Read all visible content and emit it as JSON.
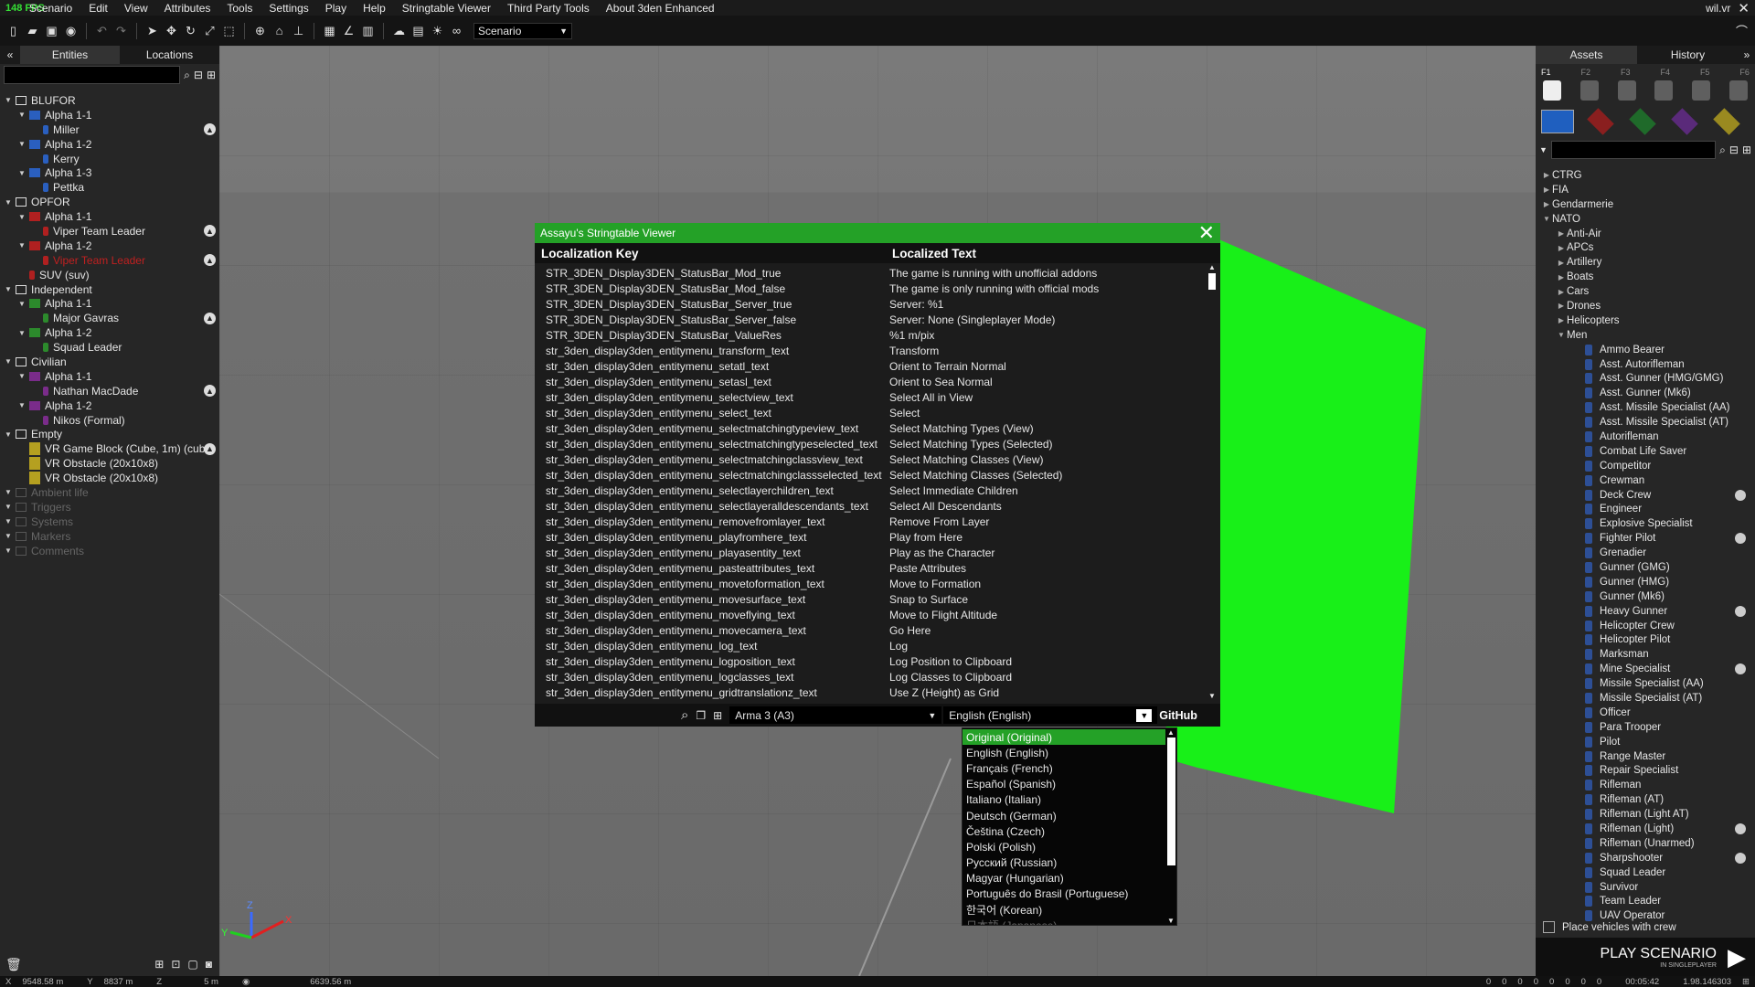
{
  "menubar": {
    "fps": "148 FPS",
    "items": [
      "Scenario",
      "Edit",
      "View",
      "Attributes",
      "Tools",
      "Settings",
      "Play",
      "Help",
      "Stringtable Viewer",
      "Third Party Tools",
      "About 3den Enhanced"
    ],
    "map_name": "wil.vr"
  },
  "toolbar": {
    "scenario_dropdown": "Scenario"
  },
  "left_panel": {
    "tabs": [
      "Entities",
      "Locations"
    ],
    "tree": [
      {
        "label": "BLUFOR",
        "level": 0,
        "kind": "folder"
      },
      {
        "label": "Alpha 1-1",
        "level": 1,
        "kind": "group",
        "color": "#2a5fbf"
      },
      {
        "label": "Miller",
        "level": 2,
        "kind": "unit",
        "color": "#2a5fbf",
        "badge": true
      },
      {
        "label": "Alpha 1-2",
        "level": 1,
        "kind": "group",
        "color": "#2a5fbf"
      },
      {
        "label": "Kerry",
        "level": 2,
        "kind": "unit",
        "color": "#2a5fbf"
      },
      {
        "label": "Alpha 1-3",
        "level": 1,
        "kind": "group",
        "color": "#2a5fbf"
      },
      {
        "label": "Pettka",
        "level": 2,
        "kind": "unit",
        "color": "#2a5fbf"
      },
      {
        "label": "OPFOR",
        "level": 0,
        "kind": "folder"
      },
      {
        "label": "Alpha 1-1",
        "level": 1,
        "kind": "group",
        "color": "#b02020"
      },
      {
        "label": "Viper Team Leader",
        "level": 2,
        "kind": "unit",
        "color": "#b02020",
        "badge": true
      },
      {
        "label": "Alpha 1-2",
        "level": 1,
        "kind": "group",
        "color": "#b02020"
      },
      {
        "label": "Viper Team Leader",
        "level": 2,
        "kind": "unit",
        "color": "#b02020",
        "badge": true,
        "red": true
      },
      {
        "label": "SUV (suv)",
        "level": 1,
        "kind": "unit",
        "color": "#b02020"
      },
      {
        "label": "Independent",
        "level": 0,
        "kind": "folder"
      },
      {
        "label": "Alpha 1-1",
        "level": 1,
        "kind": "group",
        "color": "#2c8a2c"
      },
      {
        "label": "Major Gavras",
        "level": 2,
        "kind": "unit",
        "color": "#2c8a2c",
        "badge": true
      },
      {
        "label": "Alpha 1-2",
        "level": 1,
        "kind": "group",
        "color": "#2c8a2c"
      },
      {
        "label": "Squad Leader",
        "level": 2,
        "kind": "unit",
        "color": "#2c8a2c"
      },
      {
        "label": "Civilian",
        "level": 0,
        "kind": "folder"
      },
      {
        "label": "Alpha 1-1",
        "level": 1,
        "kind": "group",
        "color": "#7a2c8a"
      },
      {
        "label": "Nathan MacDade",
        "level": 2,
        "kind": "unit",
        "color": "#7a2c8a",
        "badge": true
      },
      {
        "label": "Alpha 1-2",
        "level": 1,
        "kind": "group",
        "color": "#7a2c8a"
      },
      {
        "label": "Nikos (Formal)",
        "level": 2,
        "kind": "unit",
        "color": "#7a2c8a"
      },
      {
        "label": "Empty",
        "level": 0,
        "kind": "folder"
      },
      {
        "label": "VR Game Block (Cube, 1m) (cube)",
        "level": 1,
        "kind": "object",
        "color": "#b5a020",
        "badge": true
      },
      {
        "label": "VR Obstacle (20x10x8)",
        "level": 1,
        "kind": "object",
        "color": "#b5a020"
      },
      {
        "label": "VR Obstacle (20x10x8)",
        "level": 1,
        "kind": "object",
        "color": "#b5a020"
      },
      {
        "label": "Ambient life",
        "level": 0,
        "kind": "folder",
        "dim": true
      },
      {
        "label": "Triggers",
        "level": 0,
        "kind": "folder",
        "dim": true
      },
      {
        "label": "Systems",
        "level": 0,
        "kind": "folder",
        "dim": true
      },
      {
        "label": "Markers",
        "level": 0,
        "kind": "folder",
        "dim": true
      },
      {
        "label": "Comments",
        "level": 0,
        "kind": "folder",
        "dim": true
      }
    ]
  },
  "right_panel": {
    "tabs": [
      "Assets",
      "History"
    ],
    "slots": [
      "F1",
      "F2",
      "F3",
      "F4",
      "F5",
      "F6"
    ],
    "side_colors": [
      "#1f5fbf",
      "#8a1f1f",
      "#1f6a2a",
      "#5a2a7a",
      "#9a8a20"
    ],
    "factions": [
      "CTRG",
      "FIA",
      "Gendarmerie",
      "NATO"
    ],
    "categories": [
      "Anti-Air",
      "APCs",
      "Artillery",
      "Boats",
      "Cars",
      "Drones",
      "Helicopters",
      "Men"
    ],
    "men": [
      "Ammo Bearer",
      "Asst. Autorifleman",
      "Asst. Gunner (HMG/GMG)",
      "Asst. Gunner (Mk6)",
      "Asst. Missile Specialist (AA)",
      "Asst. Missile Specialist (AT)",
      "Autorifleman",
      "Combat Life Saver",
      "Competitor",
      "Crewman",
      "Deck Crew",
      "Engineer",
      "Explosive Specialist",
      "Fighter Pilot",
      "Grenadier",
      "Gunner (GMG)",
      "Gunner (HMG)",
      "Gunner (Mk6)",
      "Heavy Gunner",
      "Helicopter Crew",
      "Helicopter Pilot",
      "Marksman",
      "Mine Specialist",
      "Missile Specialist (AA)",
      "Missile Specialist (AT)",
      "Officer",
      "Para Trooper",
      "Pilot",
      "Range Master",
      "Repair Specialist",
      "Rifleman",
      "Rifleman (AT)",
      "Rifleman (Light AT)",
      "Rifleman (Light)",
      "Rifleman (Unarmed)",
      "Sharpshooter",
      "Squad Leader",
      "Survivor",
      "Team Leader",
      "UAV Operator"
    ],
    "checkbox_label": "Place vehicles with crew",
    "play_label": "PLAY SCENARIO",
    "play_sub": "IN SINGLEPLAYER"
  },
  "dialog": {
    "title": "Assayu's Stringtable Viewer",
    "col_key": "Localization Key",
    "col_text": "Localized Text",
    "rows": [
      [
        "STR_3DEN_Display3DEN_StatusBar_Mod_true",
        "The game is running with unofficial addons"
      ],
      [
        "STR_3DEN_Display3DEN_StatusBar_Mod_false",
        "The game is only running with official mods"
      ],
      [
        "STR_3DEN_Display3DEN_StatusBar_Server_true",
        "Server: %1"
      ],
      [
        "STR_3DEN_Display3DEN_StatusBar_Server_false",
        "Server: None (Singleplayer Mode)"
      ],
      [
        "STR_3DEN_Display3DEN_StatusBar_ValueRes",
        "%1 m/pix"
      ],
      [
        "str_3den_display3den_entitymenu_transform_text",
        "Transform"
      ],
      [
        "str_3den_display3den_entitymenu_setatl_text",
        "Orient to Terrain Normal"
      ],
      [
        "str_3den_display3den_entitymenu_setasl_text",
        "Orient to Sea Normal"
      ],
      [
        "str_3den_display3den_entitymenu_selectview_text",
        "Select All in View"
      ],
      [
        "str_3den_display3den_entitymenu_select_text",
        "Select"
      ],
      [
        "str_3den_display3den_entitymenu_selectmatchingtypeview_text",
        "Select Matching Types (View)"
      ],
      [
        "str_3den_display3den_entitymenu_selectmatchingtypeselected_text",
        "Select Matching Types (Selected)"
      ],
      [
        "str_3den_display3den_entitymenu_selectmatchingclassview_text",
        "Select Matching Classes (View)"
      ],
      [
        "str_3den_display3den_entitymenu_selectmatchingclassselected_text",
        "Select Matching Classes (Selected)"
      ],
      [
        "str_3den_display3den_entitymenu_selectlayerchildren_text",
        "Select Immediate Children"
      ],
      [
        "str_3den_display3den_entitymenu_selectlayeralldescendants_text",
        "Select All Descendants"
      ],
      [
        "str_3den_display3den_entitymenu_removefromlayer_text",
        "Remove From Layer"
      ],
      [
        "str_3den_display3den_entitymenu_playfromhere_text",
        "Play from Here"
      ],
      [
        "str_3den_display3den_entitymenu_playasentity_text",
        "Play as the Character"
      ],
      [
        "str_3den_display3den_entitymenu_pasteattributes_text",
        "Paste Attributes"
      ],
      [
        "str_3den_display3den_entitymenu_movetoformation_text",
        "Move to Formation"
      ],
      [
        "str_3den_display3den_entitymenu_movesurface_text",
        "Snap to Surface"
      ],
      [
        "str_3den_display3den_entitymenu_moveflying_text",
        "Move to Flight Altitude"
      ],
      [
        "str_3den_display3den_entitymenu_movecamera_text",
        "Go Here"
      ],
      [
        "str_3den_display3den_entitymenu_log_text",
        "Log"
      ],
      [
        "str_3den_display3den_entitymenu_logposition_text",
        "Log Position to Clipboard"
      ],
      [
        "str_3den_display3den_entitymenu_logclasses_text",
        "Log Classes to Clipboard"
      ],
      [
        "str_3den_display3den_entitymenu_gridtranslationz_text",
        "Use Z (Height) as Grid"
      ]
    ],
    "source_select": "Arma 3 (A3)",
    "language_select": "English (English)",
    "github_label": "GitHub"
  },
  "language_options": [
    {
      "label": "Original (Original)",
      "selected": true
    },
    {
      "label": "English (English)"
    },
    {
      "label": "Français (French)"
    },
    {
      "label": "Español (Spanish)"
    },
    {
      "label": "Italiano (Italian)"
    },
    {
      "label": "Deutsch (German)"
    },
    {
      "label": "Čeština (Czech)"
    },
    {
      "label": "Polski (Polish)"
    },
    {
      "label": "Русский (Russian)"
    },
    {
      "label": "Magyar (Hungarian)"
    },
    {
      "label": "Português do Brasil (Portuguese)"
    },
    {
      "label": "한국어 (Korean)"
    },
    {
      "label": "日本語 (Japanese)",
      "dim": true
    }
  ],
  "statusbar": {
    "x": "9548.58 m",
    "y": "8837 m",
    "z": "5 m",
    "dist": "6639.56 m",
    "counts": [
      "0",
      "0",
      "0",
      "0",
      "0",
      "0",
      "0",
      "0"
    ],
    "time": "00:05:42",
    "version": "1.98.146303"
  }
}
